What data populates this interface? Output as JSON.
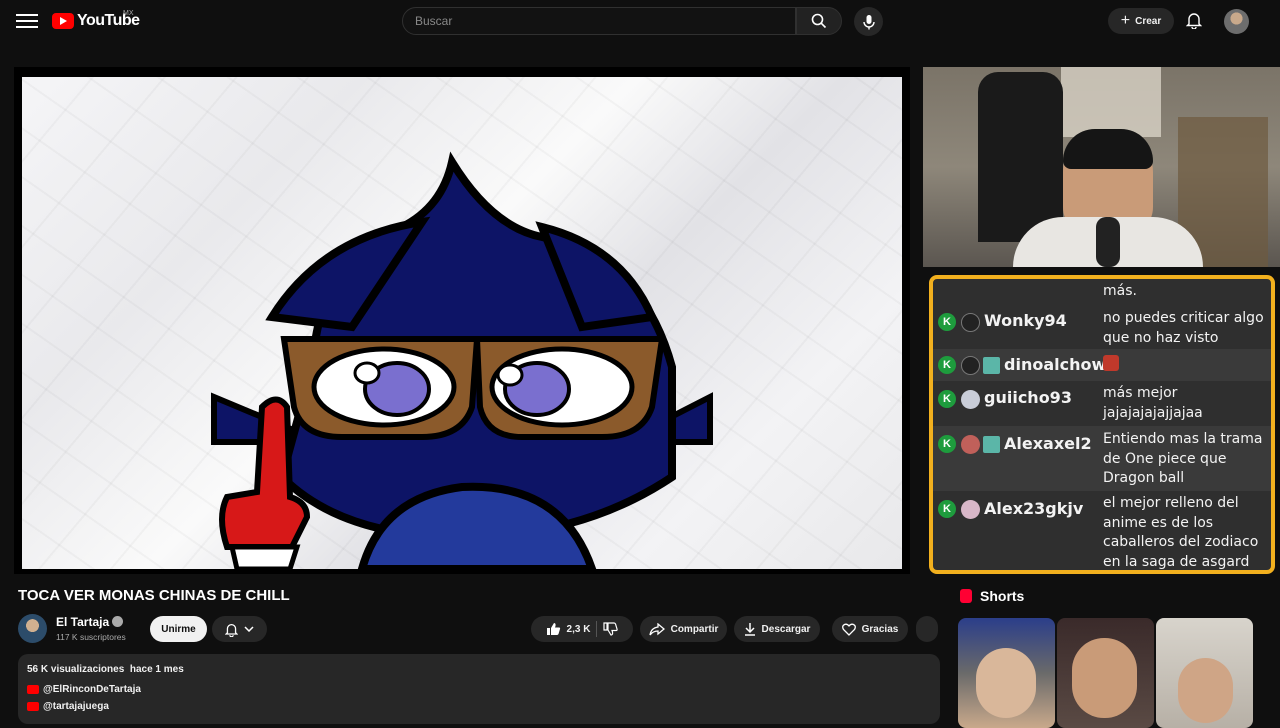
{
  "header": {
    "logo_text": "YouTube",
    "country": "MX",
    "search_placeholder": "Buscar",
    "create_label": "Crear"
  },
  "video": {
    "title": "TOCA VER MONAS CHINAS DE CHILL"
  },
  "channel": {
    "name": "El Tartaja",
    "subscribers": "117 K suscriptores",
    "join_label": "Unirme"
  },
  "actions": {
    "likes": "2,3 K",
    "share_label": "Compartir",
    "download_label": "Descargar",
    "thanks_label": "Gracias"
  },
  "description": {
    "views": "56 K visualizaciones",
    "date": "hace 1 mes",
    "links": [
      "@ElRinconDeTartaja",
      "@tartajajuega"
    ]
  },
  "chat": {
    "border_color": "#f2b01e",
    "top_text": "más.",
    "messages": [
      {
        "user": "Wonky94",
        "lines": [
          "no puedes criticar algo",
          "que no haz visto"
        ]
      },
      {
        "user": "dinoalchow",
        "lines": [
          "😡"
        ]
      },
      {
        "user": "guiicho93",
        "lines": [
          "más mejor",
          "jajajajajajjajaa"
        ]
      },
      {
        "user": "Alexaxel2",
        "lines": [
          "Entiendo mas la trama",
          "de One piece que",
          "Dragon ball"
        ]
      },
      {
        "user": "Alex23gkjv",
        "lines": [
          "el mejor relleno del",
          "anime es de los",
          "caballeros del zodiaco",
          "en la saga de asgard"
        ]
      }
    ]
  },
  "shorts": {
    "heading": "Shorts"
  }
}
